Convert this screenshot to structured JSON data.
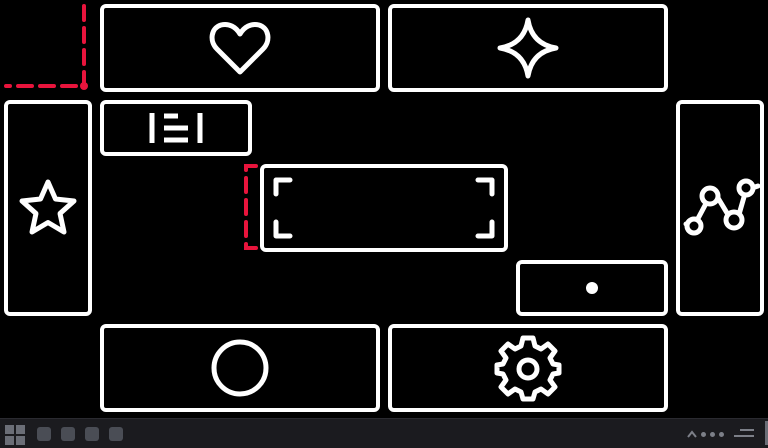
{
  "colors": {
    "background": "#000000",
    "panel_border": "#ffffff",
    "guide": "#e8143c",
    "taskbar": "#1b1b1f",
    "taskbar_icon": "#4a4d55",
    "tray_icon": "#7c7f88"
  },
  "panels": [
    {
      "id": "heart",
      "icon": "heart-icon"
    },
    {
      "id": "sparkle",
      "icon": "sparkle-icon"
    },
    {
      "id": "star",
      "icon": "star-icon"
    },
    {
      "id": "justify",
      "icon": "align-justify-icon"
    },
    {
      "id": "focus",
      "icon": "focus-frame-icon"
    },
    {
      "id": "dot",
      "icon": "dot-icon"
    },
    {
      "id": "chart",
      "icon": "line-chart-icon"
    },
    {
      "id": "circle",
      "icon": "circle-icon"
    },
    {
      "id": "gear",
      "icon": "gear-icon"
    }
  ],
  "taskbar": {
    "start_icon": "windows-grid-icon",
    "pinned_apps": [
      "app-1",
      "app-2",
      "app-3",
      "app-4"
    ],
    "tray": {
      "chevron_icon": "chevron-up-icon",
      "status_dots": 3,
      "menu_icon": "menu-lines-icon"
    }
  }
}
